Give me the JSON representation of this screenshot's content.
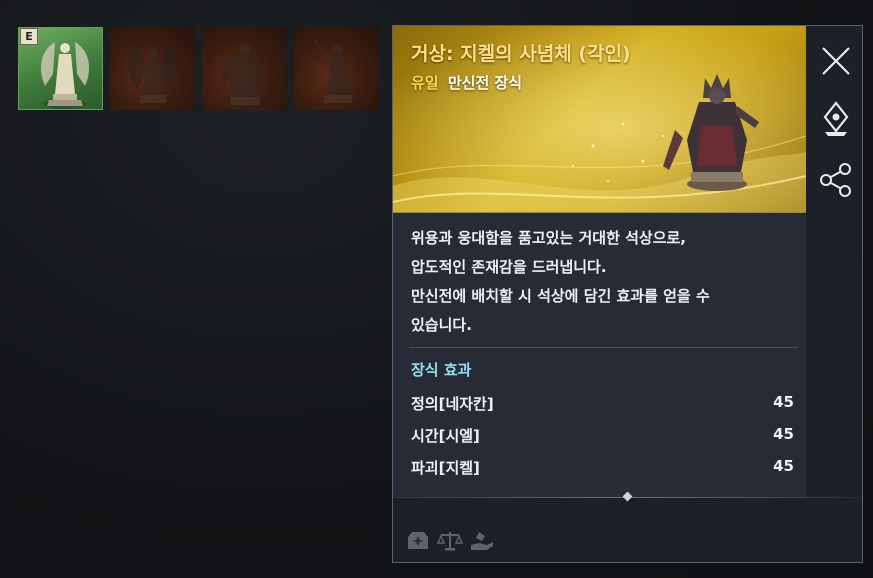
{
  "thumbnails": {
    "badge": "E",
    "items": [
      {
        "name": "thumbnail-1",
        "state": "selected"
      },
      {
        "name": "thumbnail-2",
        "state": "dim"
      },
      {
        "name": "thumbnail-3",
        "state": "dim"
      },
      {
        "name": "thumbnail-4",
        "state": "dim"
      }
    ]
  },
  "tooltip": {
    "item_name": "거상: 지켈의 사념체 (각인)",
    "rarity": "유일",
    "category": "만신전 장식",
    "description": [
      "위용과 웅대함을 품고있는 거대한 석상으로,",
      "압도적인 존재감을 드러냅니다.",
      "만신전에 배치할 시 석상에 담긴 효과를 얻을 수",
      "있습니다."
    ],
    "effect_title": "장식 효과",
    "stats": [
      {
        "label": "정의[네자칸]",
        "value": "45"
      },
      {
        "label": "시간[시엘]",
        "value": "45"
      },
      {
        "label": "파괴[지켈]",
        "value": "45"
      }
    ]
  },
  "side_buttons": [
    {
      "icon": "close-icon"
    },
    {
      "icon": "location-pin-icon"
    },
    {
      "icon": "share-icon"
    }
  ],
  "footer_icons": [
    {
      "icon": "storage-box-icon"
    },
    {
      "icon": "balance-scale-icon"
    },
    {
      "icon": "hand-give-icon"
    }
  ],
  "colors": {
    "item_name": "#ffe08a",
    "rarity": "#ffd84a",
    "effect_title": "#8fe0f2",
    "selected_thumb": "#5fa25a"
  }
}
